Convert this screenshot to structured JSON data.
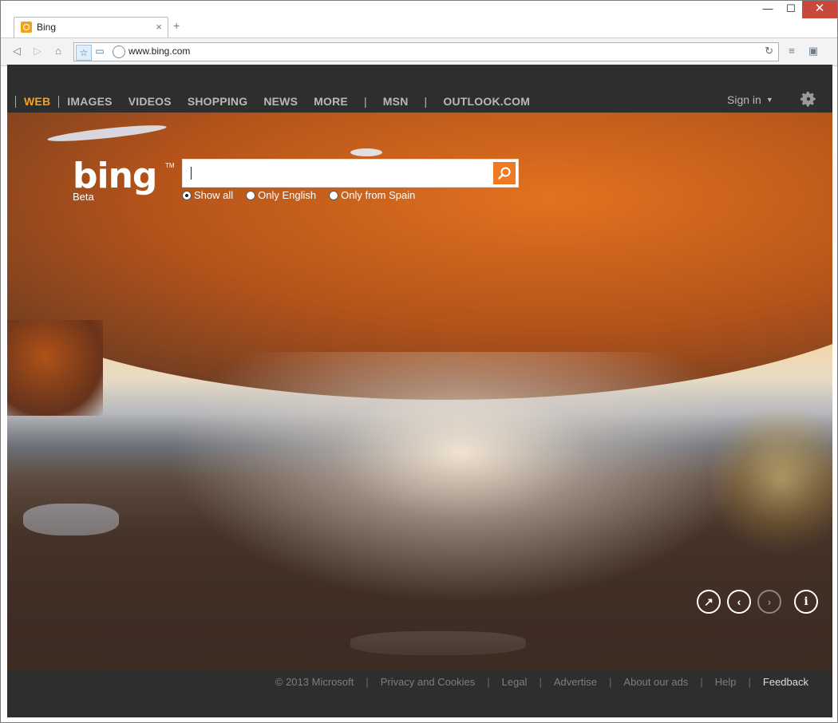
{
  "browser": {
    "tab_title": "Bing",
    "tab_close": "×",
    "new_tab": "+",
    "window_controls": {
      "minimize": "—",
      "maximize": "☐",
      "close": "✕"
    },
    "address": "www.bing.com"
  },
  "nav": {
    "items": [
      "WEB",
      "IMAGES",
      "VIDEOS",
      "SHOPPING",
      "NEWS",
      "MORE",
      "MSN",
      "OUTLOOK.COM"
    ],
    "separator": "|",
    "active": "WEB",
    "sign_in": "Sign in",
    "sign_in_caret": "▼"
  },
  "brand": {
    "logo": "bing",
    "tm": "TM",
    "beta": "Beta"
  },
  "search": {
    "value": "",
    "options": [
      "Show all",
      "Only English",
      "Only from Spain"
    ],
    "selected": "Show all"
  },
  "hero_controls": {
    "expand_icon": "↗",
    "prev_icon": "‹",
    "next_icon": "›",
    "info_icon": "i"
  },
  "footer": {
    "copyright": "© 2013 Microsoft",
    "privacy": "Privacy and Cookies",
    "legal": "Legal",
    "advertise": "Advertise",
    "about_ads": "About our ads",
    "help": "Help",
    "feedback": "Feedback",
    "separator": "|"
  },
  "colors": {
    "accent": "#f8a11c",
    "search_button": "#f07a24",
    "close_button": "#c9483c"
  }
}
